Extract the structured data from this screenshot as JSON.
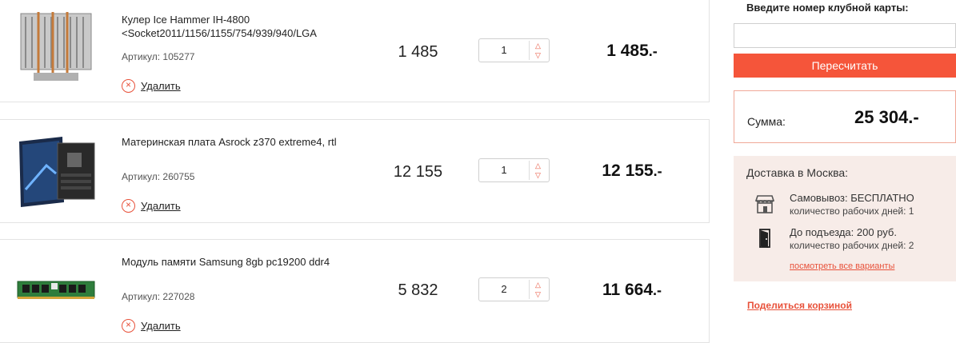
{
  "items": [
    {
      "name": "Кулер Ice Hammer IH-4800 <Socket2011/1156/1155/754/939/940/LGA",
      "sku": "Артикул: 105277",
      "delete_label": "Удалить",
      "price": "1 485",
      "qty": "1",
      "total": "1 485",
      "currency_suffix": ".-",
      "image": "cpu-cooler-icon"
    },
    {
      "name": "Материнская плата Asrock z370 extreme4, rtl",
      "sku": "Артикул: 260755",
      "delete_label": "Удалить",
      "price": "12 155",
      "qty": "1",
      "total": "12 155",
      "currency_suffix": ".-",
      "image": "motherboard-icon"
    },
    {
      "name": "Модуль памяти Samsung 8gb pc19200 ddr4",
      "sku": "Артикул: 227028",
      "delete_label": "Удалить",
      "price": "5 832",
      "qty": "2",
      "total": "11 664",
      "currency_suffix": ".-",
      "image": "ram-module-icon"
    }
  ],
  "sidebar": {
    "club_card_label": "Введите номер клубной карты:",
    "club_card_value": "",
    "recalc_label": "Пересчитать",
    "sum_label": "Сумма:",
    "sum_value": "25 304.-",
    "delivery": {
      "title": "Доставка в Москва:",
      "options": [
        {
          "line1": "Самовывоз: БЕСПЛАТНО",
          "line2": "количество рабочих дней: 1",
          "icon": "store-icon"
        },
        {
          "line1": "До подъезда: 200 руб.",
          "line2": "количество рабочих дней: 2",
          "icon": "door-icon"
        }
      ],
      "more_label": "посмотреть все варианты"
    },
    "share_label": "Поделиться корзиной"
  },
  "colors": {
    "accent": "#f5553a",
    "delivery_bg": "#f7ece8",
    "border": "#e3e3e3"
  }
}
